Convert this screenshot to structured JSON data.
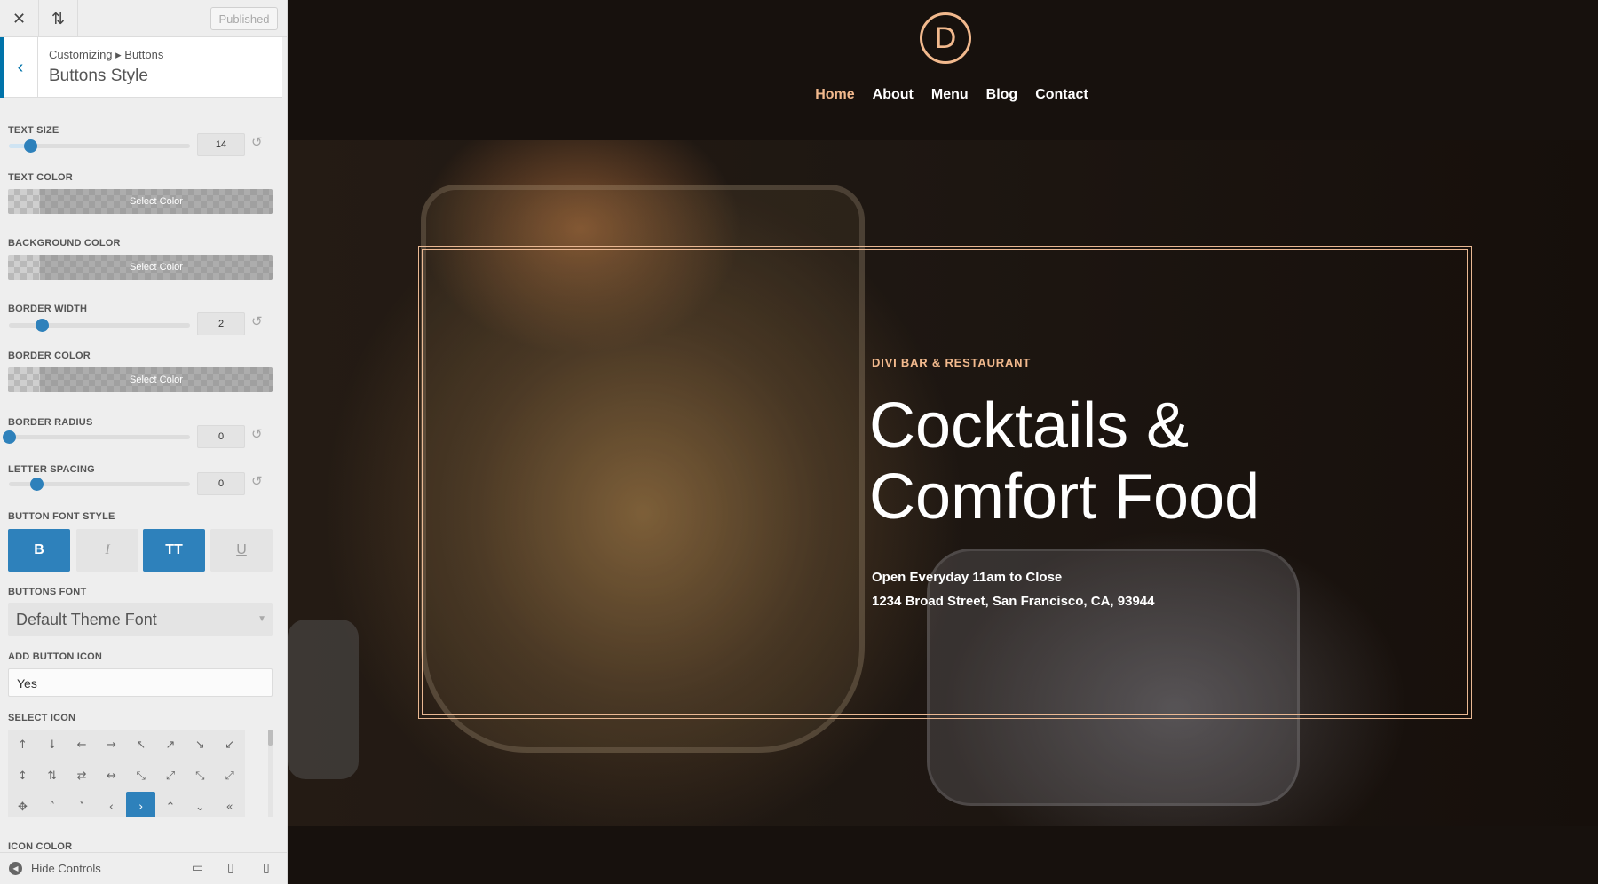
{
  "topbar": {
    "close_icon": "close-icon",
    "reorder_icon": "reorder-icon",
    "published_label": "Published"
  },
  "section": {
    "breadcrumb": "Customizing ▸ Buttons",
    "title": "Buttons Style"
  },
  "controls": {
    "text_size": {
      "label": "TEXT SIZE",
      "value": "14",
      "level": 0.12
    },
    "text_color": {
      "label": "TEXT COLOR",
      "button": "Select Color"
    },
    "background_color": {
      "label": "BACKGROUND COLOR",
      "button": "Select Color"
    },
    "border_width": {
      "label": "BORDER WIDTH",
      "value": "2",
      "level": 0.18
    },
    "border_color": {
      "label": "BORDER COLOR",
      "button": "Select Color"
    },
    "border_radius": {
      "label": "BORDER RADIUS",
      "value": "0",
      "level": 0.0
    },
    "letter_spacing": {
      "label": "LETTER SPACING",
      "value": "0",
      "level": 0.15
    },
    "button_font_style": {
      "label": "BUTTON FONT STYLE",
      "bold": "B",
      "italic": "I",
      "uppercase": "TT",
      "underline": "U"
    },
    "buttons_font": {
      "label": "BUTTONS FONT",
      "value": "Default Theme Font"
    },
    "add_button_icon": {
      "label": "ADD BUTTON ICON",
      "value": "Yes"
    },
    "select_icon": {
      "label": "SELECT ICON",
      "selected": "›"
    },
    "icon_color": {
      "label": "ICON COLOR"
    }
  },
  "icons": [
    "↑",
    "↓",
    "←",
    "→",
    "↖",
    "↗",
    "↘",
    "↙",
    "↕",
    "⇅",
    "⇄",
    "↔",
    "⤡",
    "⤢",
    "⤡",
    "⤢",
    "✥",
    "˄",
    "˅",
    "‹",
    "›",
    "⌃",
    "⌄",
    "«"
  ],
  "footer": {
    "hide_controls": "Hide Controls",
    "desktop_icon": "desktop-icon",
    "tablet_icon": "tablet-icon",
    "phone_icon": "phone-icon"
  },
  "site": {
    "logo_letter": "D",
    "nav": [
      "Home",
      "About",
      "Menu",
      "Blog",
      "Contact"
    ],
    "kicker": "DIVI BAR & RESTAURANT",
    "headline": "Cocktails & Comfort Food",
    "hours": "Open Everyday 11am to Close",
    "address": "1234 Broad Street, San Francisco, CA, 93944",
    "accent_color": "#f2b98d"
  },
  "colors": {
    "wp_blue": "#0073aa",
    "control_blue": "#2e81bb",
    "page_bg": "#17110d"
  }
}
